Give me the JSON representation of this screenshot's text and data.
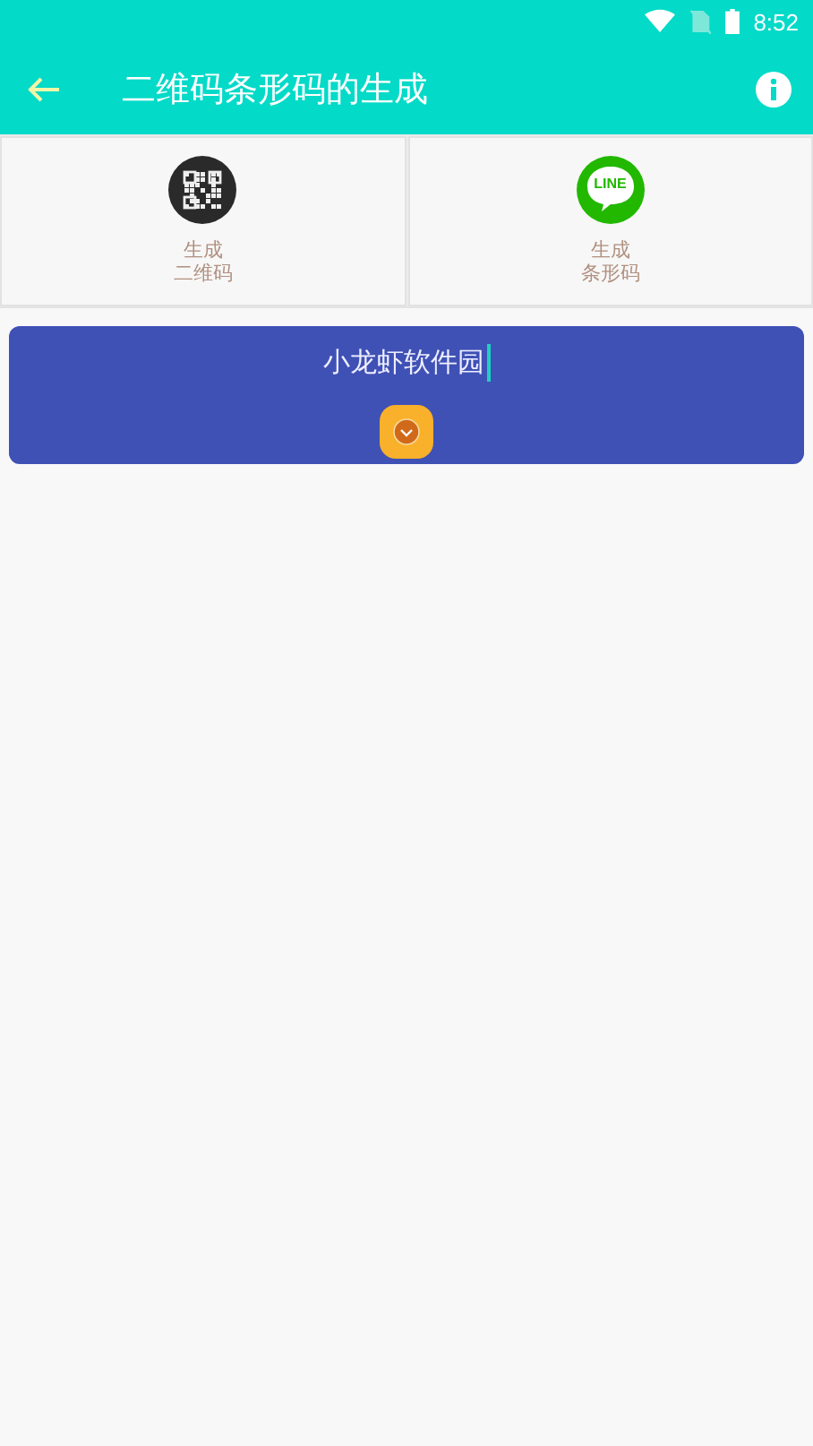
{
  "status_bar": {
    "time": "8:52"
  },
  "toolbar": {
    "title": "二维码条形码的生成"
  },
  "tabs": [
    {
      "kind": "qr",
      "label": [
        "生成",
        "二维码"
      ]
    },
    {
      "kind": "chat",
      "badge": "LINE",
      "label": [
        "生成",
        "条形码"
      ]
    }
  ],
  "input": {
    "value": "小龙虾软件园",
    "focused": true
  }
}
